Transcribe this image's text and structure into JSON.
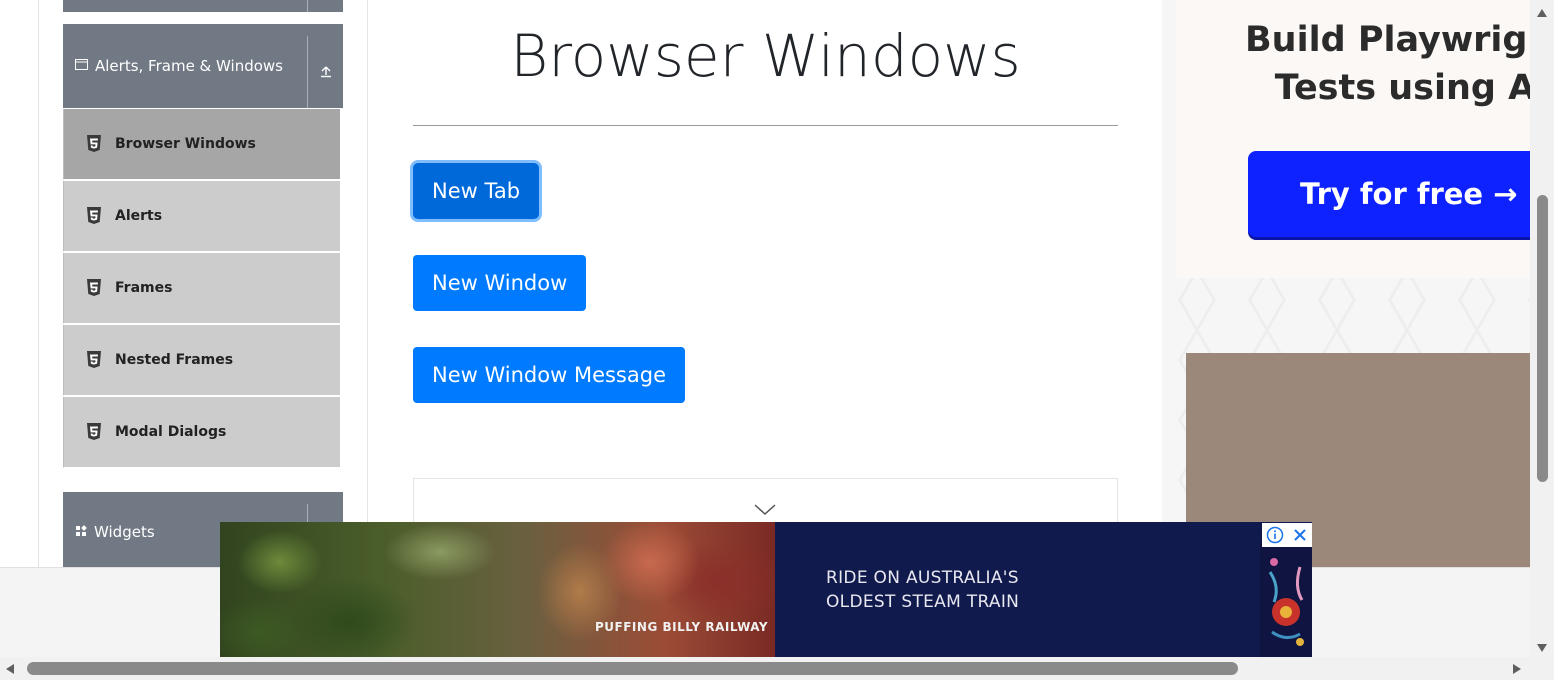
{
  "sidebar": {
    "group_top": {
      "label": "Alerts, Frame & Windows",
      "icon": "window-icon",
      "toggle_icon": "arrow-up-icon"
    },
    "items": [
      {
        "label": "Browser Windows",
        "icon": "html5-icon",
        "active": true
      },
      {
        "label": "Alerts",
        "icon": "html5-icon",
        "active": false
      },
      {
        "label": "Frames",
        "icon": "html5-icon",
        "active": false
      },
      {
        "label": "Nested Frames",
        "icon": "html5-icon",
        "active": false
      },
      {
        "label": "Modal Dialogs",
        "icon": "html5-icon",
        "active": false
      }
    ],
    "group_next": {
      "label": "Widgets",
      "icon": "widgets-icon"
    }
  },
  "main": {
    "title": "Browser Windows",
    "buttons": {
      "new_tab": "New Tab",
      "new_window": "New Window",
      "new_window_message": "New Window Message"
    },
    "collapse_icon": "chevron-down-icon"
  },
  "right_ad": {
    "title_line1": "Build Playwright",
    "title_line2": "Tests using A",
    "cta": "Try for free →"
  },
  "banner_ad": {
    "photo_caption": "PUFFING BILLY RAILWAY",
    "headline_line1": "RIDE ON AUSTRALIA'S",
    "headline_line2": "OLDEST STEAM TRAIN",
    "info_icon": "info-icon",
    "close_icon": "close-icon"
  },
  "colors": {
    "sidebar_header": "#707984",
    "menu_item": "#cccccc",
    "menu_item_active": "#a6a6a6",
    "primary_button": "#007bff",
    "ad_cta": "#0e22ff",
    "banner_bg": "#111a4d"
  }
}
